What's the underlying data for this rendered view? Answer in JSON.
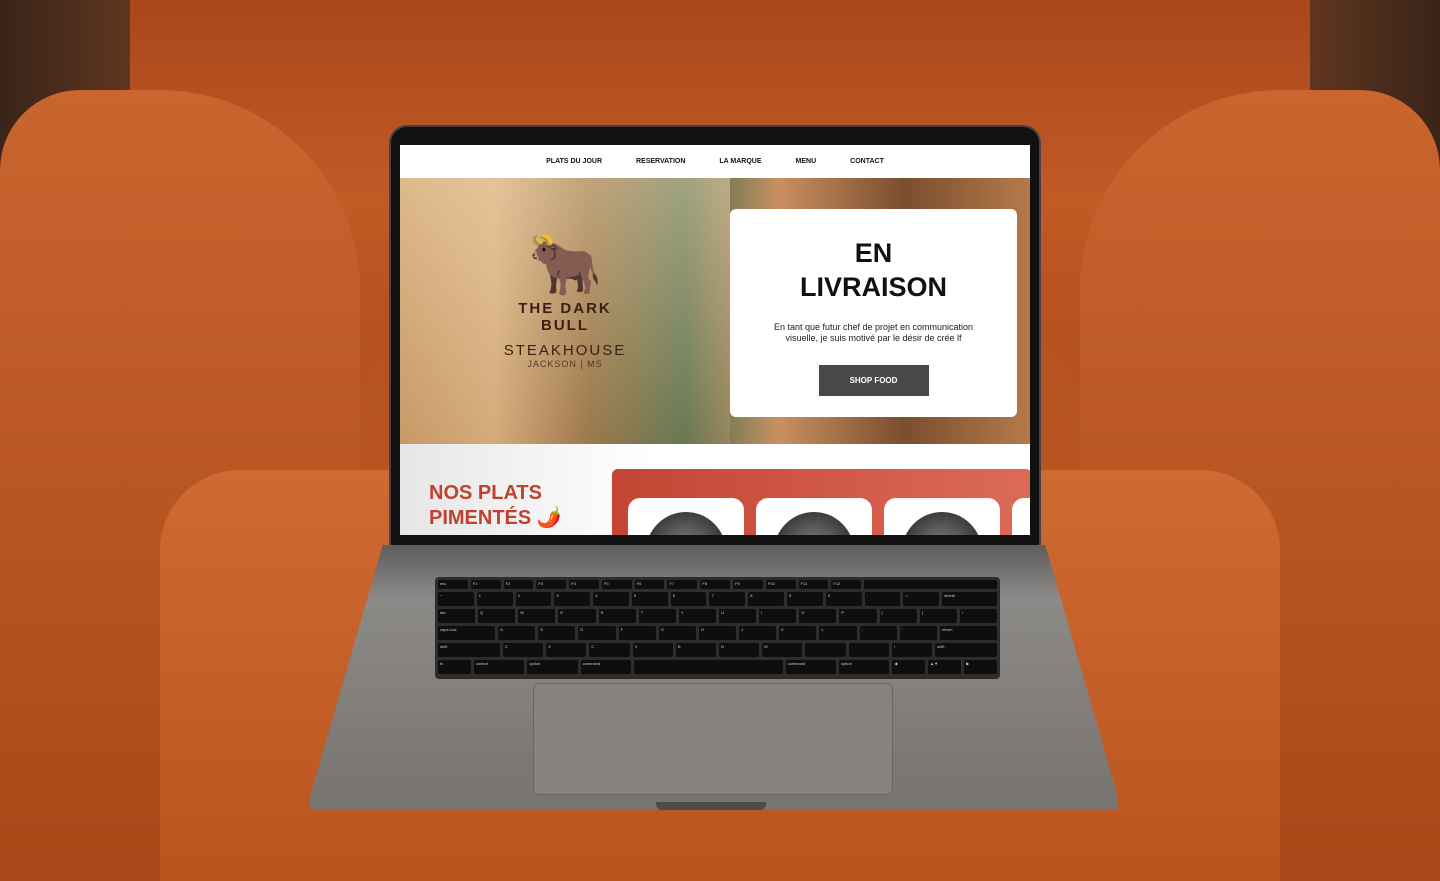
{
  "nav": [
    "PLATS DU JOUR",
    "RESERVATION",
    "LA MARQUE",
    "MENU",
    "CONTACT"
  ],
  "logo": {
    "brand": "THE DARK BULL",
    "type": "STEAKHOUSE",
    "city": "JACKSON | MS"
  },
  "hero": {
    "title_line1": "EN",
    "title_line2": "LIVRAISON",
    "text": "En tant que futur chef de projet en communication visuelle, je suis motivé par le désir de crée lf",
    "button": "SHOP FOOD"
  },
  "section": {
    "title_line1": "NOS PLATS",
    "title_line2": "PIMENTÉS",
    "icon": "chili-pepper-icon"
  },
  "keyboard": {
    "rows": [
      [
        "esc",
        "F1",
        "F2",
        "F3",
        "F4",
        "F5",
        "F6",
        "F7",
        "F8",
        "F9",
        "F10",
        "F11",
        "F12",
        ""
      ],
      [
        "~",
        "1",
        "2",
        "3",
        "4",
        "5",
        "6",
        "7",
        "8",
        "9",
        "0",
        "-",
        "=",
        "delete"
      ],
      [
        "tab",
        "Q",
        "W",
        "E",
        "R",
        "T",
        "Y",
        "U",
        "I",
        "O",
        "P",
        "[",
        "]",
        "\\"
      ],
      [
        "caps lock",
        "A",
        "S",
        "D",
        "F",
        "G",
        "H",
        "J",
        "K",
        "L",
        ";",
        "'",
        "return"
      ],
      [
        "shift",
        "Z",
        "X",
        "C",
        "V",
        "B",
        "N",
        "M",
        ",",
        ".",
        "/",
        "shift"
      ],
      [
        "fn",
        "control",
        "option",
        "command",
        "",
        "command",
        "option",
        "◀",
        "▲▼",
        "▶"
      ]
    ]
  },
  "colors": {
    "accent": "#c0412e",
    "button": "#484848"
  }
}
